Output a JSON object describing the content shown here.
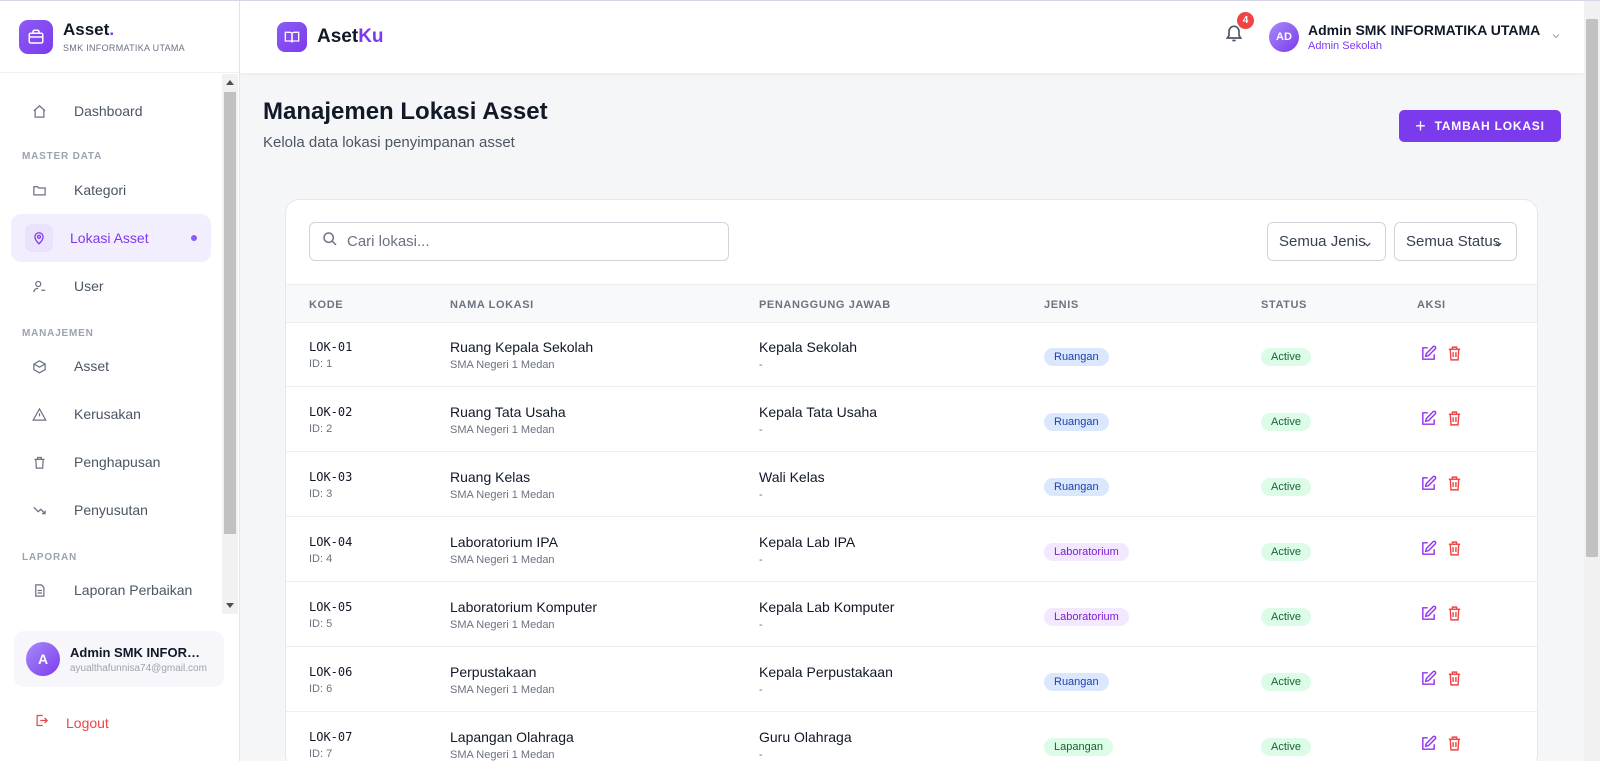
{
  "sidebar": {
    "brand_name": "Asset",
    "brand_dot": ".",
    "brand_sub": "SMK INFORMATIKA UTAMA",
    "items": [
      {
        "label": "Dashboard",
        "icon": "home-icon"
      },
      {
        "label": "Kategori",
        "icon": "folder-icon"
      },
      {
        "label": "Lokasi Asset",
        "icon": "map-pin-icon",
        "active": true
      },
      {
        "label": "User",
        "icon": "user-icon"
      },
      {
        "label": "Asset",
        "icon": "box-icon"
      },
      {
        "label": "Kerusakan",
        "icon": "warning-icon"
      },
      {
        "label": "Penghapusan",
        "icon": "trash-icon"
      },
      {
        "label": "Penyusutan",
        "icon": "trend-down-icon"
      },
      {
        "label": "Laporan Perbaikan",
        "icon": "document-icon"
      }
    ],
    "sections": {
      "master": "MASTER DATA",
      "manajemen": "MANAJEMEN",
      "laporan": "LAPORAN"
    },
    "user": {
      "initial": "A",
      "name": "Admin SMK INFORMATIKA UTAMA",
      "email": "ayualthafunnisa74@gmail.com"
    },
    "logout_label": "Logout"
  },
  "header": {
    "brand_prefix": "Aset",
    "brand_suffix": "Ku",
    "notification_count": "4",
    "profile_initials": "AD",
    "profile_name": "Admin SMK INFORMATIKA UTAMA",
    "profile_role": "Admin Sekolah"
  },
  "page": {
    "title": "Manajemen Lokasi Asset",
    "subtitle": "Kelola data lokasi penyimpanan asset",
    "add_button": "TAMBAH LOKASI"
  },
  "filters": {
    "search_placeholder": "Cari lokasi...",
    "jenis_selected": "Semua Jenis",
    "status_selected": "Semua Status"
  },
  "table": {
    "columns": [
      "KODE",
      "NAMA LOKASI",
      "PENANGGUNG JAWAB",
      "JENIS",
      "STATUS",
      "AKSI"
    ],
    "rows": [
      {
        "code": "LOK-01",
        "id": "ID: 1",
        "name": "Ruang Kepala Sekolah",
        "school": "SMA Negeri 1 Medan",
        "pj": "Kepala Sekolah",
        "pj_sub": "-",
        "jenis": "Ruangan",
        "status": "Active"
      },
      {
        "code": "LOK-02",
        "id": "ID: 2",
        "name": "Ruang Tata Usaha",
        "school": "SMA Negeri 1 Medan",
        "pj": "Kepala Tata Usaha",
        "pj_sub": "-",
        "jenis": "Ruangan",
        "status": "Active"
      },
      {
        "code": "LOK-03",
        "id": "ID: 3",
        "name": "Ruang Kelas",
        "school": "SMA Negeri 1 Medan",
        "pj": "Wali Kelas",
        "pj_sub": "-",
        "jenis": "Ruangan",
        "status": "Active"
      },
      {
        "code": "LOK-04",
        "id": "ID: 4",
        "name": "Laboratorium IPA",
        "school": "SMA Negeri 1 Medan",
        "pj": "Kepala Lab IPA",
        "pj_sub": "-",
        "jenis": "Laboratorium",
        "status": "Active"
      },
      {
        "code": "LOK-05",
        "id": "ID: 5",
        "name": "Laboratorium Komputer",
        "school": "SMA Negeri 1 Medan",
        "pj": "Kepala Lab Komputer",
        "pj_sub": "-",
        "jenis": "Laboratorium",
        "status": "Active"
      },
      {
        "code": "LOK-06",
        "id": "ID: 6",
        "name": "Perpustakaan",
        "school": "SMA Negeri 1 Medan",
        "pj": "Kepala Perpustakaan",
        "pj_sub": "-",
        "jenis": "Ruangan",
        "status": "Active"
      },
      {
        "code": "LOK-07",
        "id": "ID: 7",
        "name": "Lapangan Olahraga",
        "school": "SMA Negeri 1 Medan",
        "pj": "Guru Olahraga",
        "pj_sub": "-",
        "jenis": "Lapangan",
        "status": "Active"
      }
    ]
  },
  "colors": {
    "accent": "#7c3aed",
    "danger": "#ef4444",
    "success_bg": "#dcfce7"
  }
}
